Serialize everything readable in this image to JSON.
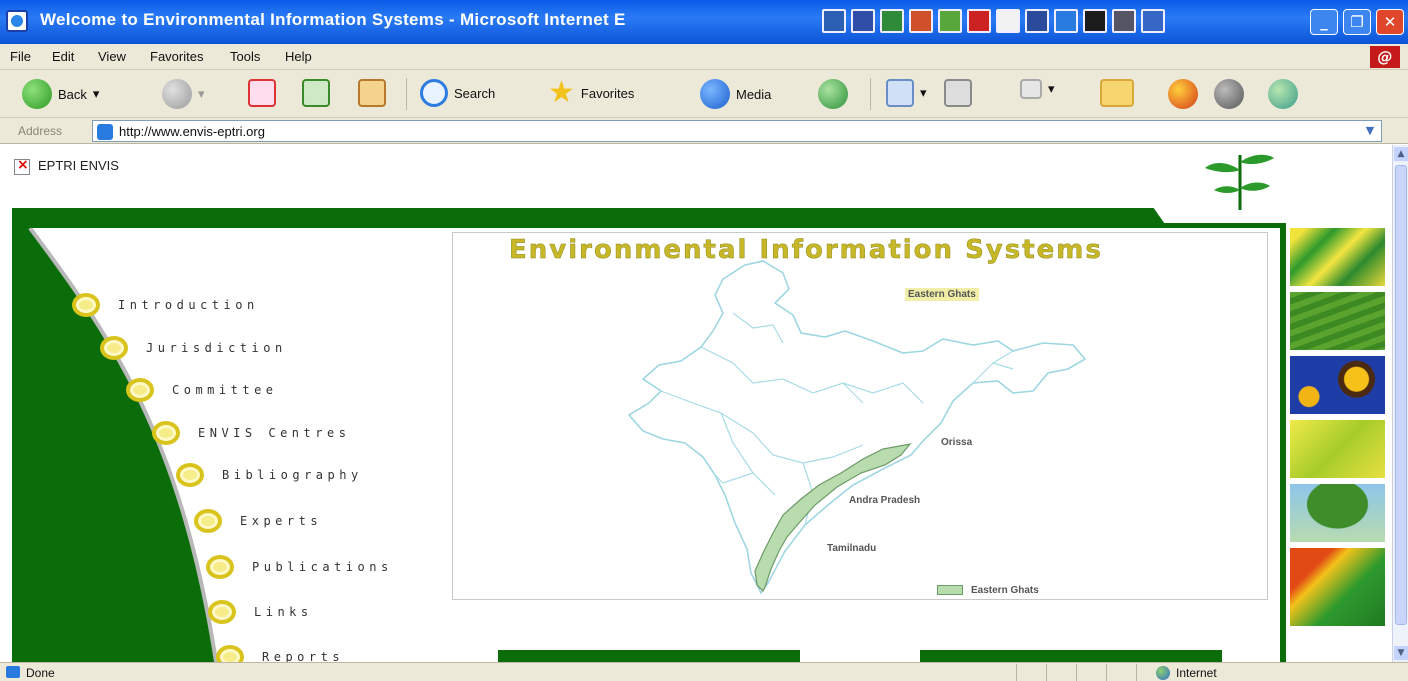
{
  "window": {
    "title": "Welcome to Environmental Information Systems - Microsoft Internet E"
  },
  "menu": [
    "File",
    "Edit",
    "View",
    "Favorites",
    "Tools",
    "Help"
  ],
  "toolbar": {
    "back": "Back",
    "search": "Search",
    "favorites": "Favorites",
    "media": "Media"
  },
  "address": {
    "label": "Address",
    "url": "http://www.envis-eptri.org"
  },
  "page": {
    "site_alt": "EPTRI ENVIS",
    "map_title": "Environmental Information Systems",
    "nav": [
      "Introduction",
      "Jurisdiction",
      "Committee",
      "ENVIS Centres",
      "Bibliography",
      "Experts",
      "Publications",
      "Links",
      "Reports"
    ],
    "map_labels": {
      "eastern_ghats_header": "Eastern Ghats",
      "orissa": "Orissa",
      "andhra": "Andra Pradesh",
      "tamil": "Tamilnadu",
      "legend": "Eastern Ghats"
    }
  },
  "status": {
    "left": "Done",
    "zone": "Internet"
  },
  "colors": {
    "forest_green": "#0a6d0a",
    "title_yellow": "#c8b828",
    "xp_blue": "#0a5ce8"
  }
}
